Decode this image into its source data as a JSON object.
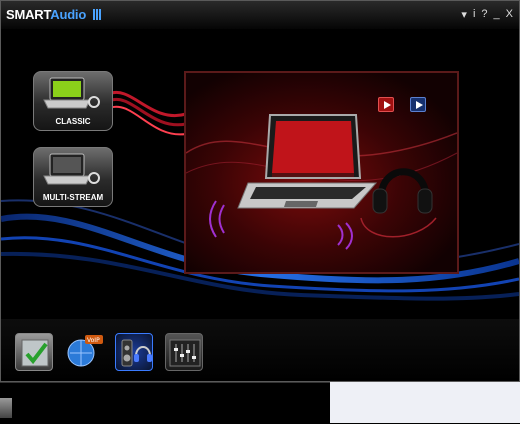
{
  "app": {
    "title_part1": "SMART",
    "title_part2": "Audio"
  },
  "titlebar": {
    "menu_glyph": "▾",
    "info": "i",
    "help": "?",
    "minimize": "_",
    "close": "X"
  },
  "modes": [
    {
      "label": "CLASSIC",
      "icon": "laptop-icon",
      "selected": true
    },
    {
      "label": "MULTI-STREAM",
      "icon": "laptop-headset-icon",
      "selected": false
    }
  ],
  "preview": {
    "outputs": [
      "laptop-speakers",
      "headphones"
    ],
    "test_buttons": [
      {
        "icon": "play-icon",
        "color": "#a01010"
      },
      {
        "icon": "play-icon",
        "color": "#16306e"
      }
    ]
  },
  "dock": {
    "items": [
      {
        "icon": "checklist-icon",
        "selected": false
      },
      {
        "icon": "voip-globe-icon",
        "selected": false
      },
      {
        "icon": "speaker-headphone-icon",
        "selected": true
      },
      {
        "icon": "equalizer-icon",
        "selected": false
      }
    ]
  },
  "colors": {
    "accent_blue": "#4aa3ff",
    "preview_red": "#8a0e12",
    "wave_blue": "#1a6bff"
  }
}
